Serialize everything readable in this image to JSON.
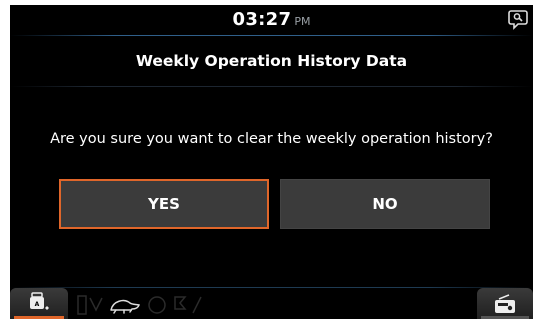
{
  "clock": {
    "time": "03:27",
    "ampm": "PM"
  },
  "dialog": {
    "title": "Weekly Operation History Data",
    "message": "Are you sure you want to clear the weekly operation history?",
    "yes_label": "YES",
    "no_label": "NO"
  },
  "icons": {
    "voice": "voice-recognition-icon",
    "eco_auto": "eco-drive-auto-icon",
    "eco_faded": "eco-faded-icons",
    "eco_turtle": "eco-turtle-icon",
    "audio": "radio-audio-icon"
  },
  "colors": {
    "accent": "#e0662a",
    "button_bg": "#3b3b3b",
    "divider": "#2f5f8a"
  }
}
